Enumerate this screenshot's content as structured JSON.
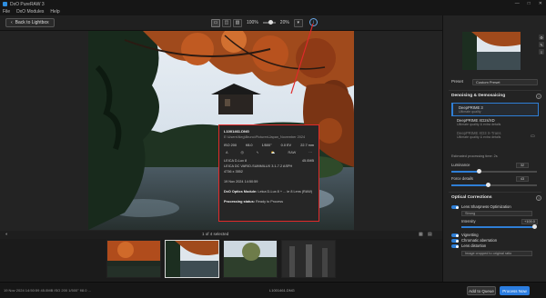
{
  "app": {
    "title": "DxO PureRAW 3",
    "window_controls": [
      "—",
      "□",
      "✕"
    ]
  },
  "menu": {
    "items": [
      "File",
      "DxO Modules",
      "Help"
    ]
  },
  "toolbar": {
    "back_label": "Back to Lightbox",
    "zoom_fit": "100%",
    "zoom_level": "20%"
  },
  "popup": {
    "filename": "L1001461.DNG",
    "path": "E:\\Users\\Neg\\Bruno\\Pictures\\Japan_November 2024",
    "exif": {
      "iso": "ISO 200",
      "aperture": "f/8.0",
      "shutter": "1/500\"",
      "ev": "0.0 EV",
      "focal": "22.7 mm"
    },
    "icon_labels": {
      "raw": "RAW",
      "more": "···"
    },
    "camera": "LEICA D-Lux 8",
    "size": "45.0MB",
    "lens": "LEICA DC VARIO-SUMMILUX 3.1-7.2 ASPH",
    "dims": "4736 x 3552",
    "date": "19 Nov 2024 14:50:59",
    "optics_label": "DxO Optics Module:",
    "optics_value": "Leica D-Lux 8 + ... ie 8 Lens (RAW)",
    "status_label": "Processing status:",
    "status_value": "Ready to Process"
  },
  "badge": {
    "label": "DeepPRIME 3"
  },
  "filmstrip": {
    "selection_text": "1 of 4 selected"
  },
  "status": {
    "exif": "19 Nov 2024 14:50:59   45.0MB   ISO 200   1/500\"   f/8.0   ...",
    "filename": "L1001461.DNG",
    "queue_label": "Add to Queue",
    "process_label": "Process Now"
  },
  "panel": {
    "preset_label": "Preset",
    "preset_value": "Custom Preset",
    "denoising_title": "Denoising & Demosaicing",
    "options": [
      {
        "name": "DeepPRIME 3",
        "sub": "Ultimate quality"
      },
      {
        "name": "DeepPRIME XD2s/XD",
        "sub": "Ultimate quality & extra details"
      },
      {
        "name": "DeepPRIME XD3 X-Trans",
        "sub": "Ultimate quality & extra details"
      }
    ],
    "est_time": "Estimated processing time: 2s",
    "luminance_label": "Luminance",
    "luminance_value": "32",
    "luminance_frac": 0.32,
    "force_label": "Force details",
    "force_value": "43",
    "force_frac": 0.43,
    "optical_title": "Optical Corrections",
    "lens_sharpness": "Lens Sharpness Optimization",
    "sharpness_mode": "Strong",
    "intensity_label": "Intensity",
    "intensity_value": "+100.0",
    "intensity_frac": 1.0,
    "vignetting": "Vignetting",
    "chromatic": "Chromatic aberration",
    "distortion": "Lens distortion",
    "distortion_mode": "Image cropped to original ratio"
  },
  "colors": {
    "accent": "#2f7fd6",
    "highlight": "#e02a2a",
    "process": "#2b7de0"
  }
}
